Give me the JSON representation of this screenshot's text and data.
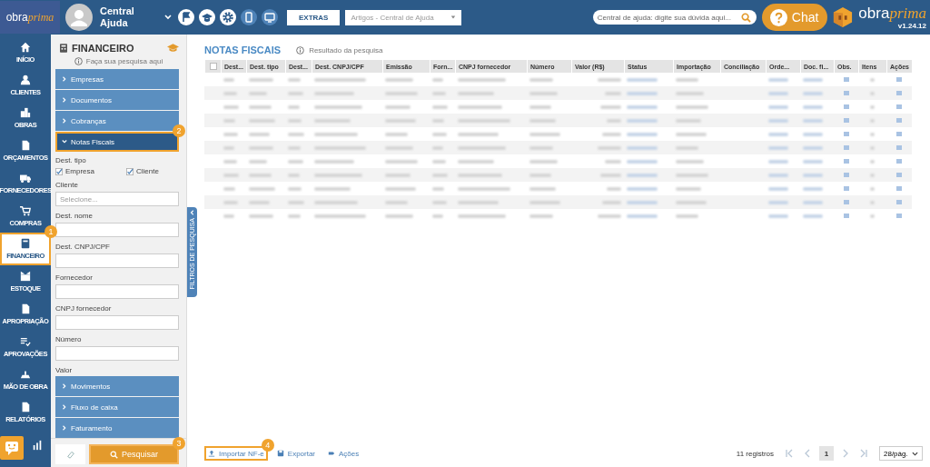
{
  "topbar": {
    "brand": {
      "a": "obra",
      "b": "prima"
    },
    "user": {
      "name": "Central Ajuda"
    },
    "tools": [
      {
        "kind": "flag",
        "selected": false
      },
      {
        "kind": "cap",
        "selected": false
      },
      {
        "kind": "gear",
        "selected": false
      },
      {
        "kind": "phone",
        "selected": true
      },
      {
        "kind": "monitor",
        "selected": true
      }
    ],
    "extras": "EXTRAS",
    "articles": {
      "placeholder": "Artigos - Central de Ajuda"
    },
    "help_search": {
      "placeholder": "Central de ajuda: digite sua dúvida aqui..."
    },
    "chat": "Chat",
    "logo": {
      "a": "obra",
      "b": "prima",
      "version": "v1.24.12"
    }
  },
  "nav": [
    {
      "kind": "home",
      "label": "INÍCIO",
      "selected": false
    },
    {
      "kind": "person",
      "label": "CLIENTES",
      "selected": false
    },
    {
      "kind": "building",
      "label": "OBRAS",
      "selected": false
    },
    {
      "kind": "doc",
      "label": "ORÇAMENTOS",
      "selected": false
    },
    {
      "kind": "truck",
      "label": "FORNECEDORES",
      "selected": false
    },
    {
      "kind": "cart",
      "label": "COMPRAS",
      "selected": false
    },
    {
      "kind": "calc",
      "label": "FINANCEIRO",
      "selected": true,
      "callout": "1"
    },
    {
      "kind": "boxes",
      "label": "ESTOQUE",
      "selected": false
    },
    {
      "kind": "doc",
      "label": "APROPRIAÇÃO",
      "selected": false
    },
    {
      "kind": "list",
      "label": "APROVAÇÕES",
      "selected": false
    },
    {
      "kind": "crane",
      "label": "MÃO DE OBRA",
      "selected": false
    },
    {
      "kind": "doc",
      "label": "RELATÓRIOS",
      "selected": false
    },
    {
      "kind": "bars",
      "selected": false
    }
  ],
  "filters": {
    "title": "FINANCEIRO",
    "hint": "Faça sua pesquisa aqui",
    "sections_before": [
      {
        "label": "Empresas",
        "expanded": false
      },
      {
        "label": "Documentos",
        "expanded": false
      },
      {
        "label": "Cobranças",
        "expanded": false
      },
      {
        "label": "Notas Fiscais",
        "expanded": true,
        "callout": "2"
      }
    ],
    "dest_tipo": {
      "label": "Dest. tipo",
      "options": [
        {
          "label": "Empresa",
          "checked": true
        },
        {
          "label": "Cliente",
          "checked": true
        }
      ]
    },
    "fields": [
      {
        "label": "Cliente",
        "placeholder": "Selecione..."
      },
      {
        "label": "Dest. nome"
      },
      {
        "label": "Dest. CNPJ/CPF"
      },
      {
        "label": "Fornecedor"
      },
      {
        "label": "CNPJ fornecedor"
      },
      {
        "label": "Número"
      }
    ],
    "valor": "Valor",
    "sections_after": [
      {
        "label": "Movimentos",
        "expanded": false
      },
      {
        "label": "Fluxo de caixa",
        "expanded": false
      },
      {
        "label": "Faturamento",
        "expanded": false
      }
    ],
    "search_button": {
      "label": "Pesquisar",
      "callout": "3"
    },
    "side_tab": "FILTROS DE PESQUISA"
  },
  "main": {
    "title": "NOTAS FISCAIS",
    "subtitle": "Resultado da pesquisa",
    "select_all": {
      "checked": false
    },
    "columns": [
      {
        "label": "Dest...",
        "kind": "text"
      },
      {
        "label": "Dest. tipo",
        "kind": "text"
      },
      {
        "label": "Dest...",
        "kind": "text"
      },
      {
        "label": "Dest. CNPJ/CPF",
        "kind": "text"
      },
      {
        "label": "Emissão",
        "kind": "text"
      },
      {
        "label": "Forn...",
        "kind": "text"
      },
      {
        "label": "CNPJ fornecedor",
        "kind": "text"
      },
      {
        "label": "Número",
        "kind": "text"
      },
      {
        "label": "Valor (R$)",
        "kind": "number"
      },
      {
        "label": "Status",
        "kind": "link"
      },
      {
        "label": "Importação",
        "kind": "text"
      },
      {
        "label": "Conciliação",
        "kind": "empty"
      },
      {
        "label": "Orde...",
        "kind": "link"
      },
      {
        "label": "Doc. fi...",
        "kind": "link"
      },
      {
        "label": "Obs.",
        "kind": "icon"
      },
      {
        "label": "Itens",
        "kind": "small"
      },
      {
        "label": "Ações",
        "kind": "icon"
      }
    ],
    "rows": [
      {
        "kind": "blurred"
      },
      {
        "kind": "blurred"
      },
      {
        "kind": "blurred"
      },
      {
        "kind": "blurred"
      },
      {
        "kind": "blurred"
      },
      {
        "kind": "blurred"
      },
      {
        "kind": "blurred"
      },
      {
        "kind": "blurred"
      },
      {
        "kind": "blurred"
      },
      {
        "kind": "blurred"
      },
      {
        "kind": "blurred"
      }
    ],
    "actions": [
      {
        "kind": "upload",
        "label": "Importar NF-e",
        "callout": "4"
      },
      {
        "kind": "save",
        "label": "Exportar"
      },
      {
        "kind": "tag",
        "label": "Ações"
      }
    ],
    "count": "11 registros",
    "pages": [
      {
        "label": "1",
        "selected": true
      }
    ],
    "per_page": "28/pág."
  }
}
